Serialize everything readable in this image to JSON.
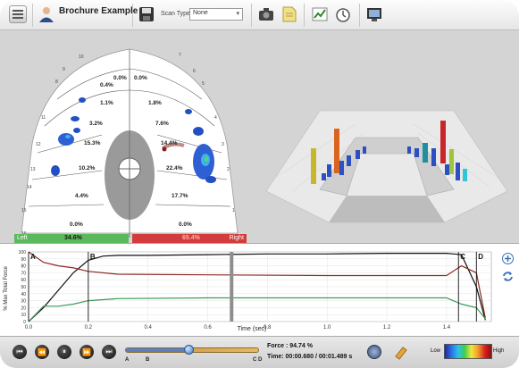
{
  "toolbar": {
    "title": "Brochure Example",
    "scan_type_label": "Scan Type:",
    "scan_type_value": "None"
  },
  "arch": {
    "left_values": [
      "0.0%",
      "0.4%",
      "1.1%",
      "3.2%",
      "15.3%",
      "10.2%",
      "4.4%",
      "0.0%"
    ],
    "right_values": [
      "0.0%",
      "1.8%",
      "7.6%",
      "14.4%",
      "22.4%",
      "17.7%",
      "0.0%"
    ],
    "tooth_numbers": [
      "10",
      "9",
      "8",
      "7",
      "11",
      "12",
      "13",
      "14",
      "15",
      "16",
      "6",
      "5",
      "4",
      "3",
      "2",
      "1"
    ],
    "left_label": "Left",
    "left_value": "34.6%",
    "right_label": "Right",
    "right_value": "65.4%"
  },
  "graph": {
    "ylabel": "% Max Total Force",
    "xlabel": "Time (sec)",
    "markers": [
      "A",
      "B",
      "C",
      "D"
    ],
    "zoom_icon": "zoom-in-icon",
    "refresh_icon": "refresh-icon"
  },
  "chart_data": {
    "type": "line",
    "xlabel": "Time (sec)",
    "ylabel": "% Max Total Force",
    "xlim": [
      0,
      1.55
    ],
    "ylim": [
      0,
      100
    ],
    "x_ticks": [
      "0.0",
      "0.2",
      "0.4",
      "0.6",
      "0.8",
      "1.0",
      "1.2",
      "1.4"
    ],
    "y_ticks": [
      "0",
      "10",
      "20",
      "30",
      "40",
      "50",
      "60",
      "70",
      "80",
      "90",
      "100"
    ],
    "series": [
      {
        "color": "#111111",
        "x": [
          0.0,
          0.05,
          0.1,
          0.15,
          0.2,
          0.25,
          0.3,
          0.4,
          0.6,
          0.8,
          1.0,
          1.2,
          1.4,
          1.45,
          1.5,
          1.53
        ],
        "y": [
          0,
          20,
          45,
          70,
          88,
          94,
          95,
          95,
          96,
          97,
          97,
          98,
          98,
          96,
          50,
          2
        ]
      },
      {
        "color": "#8b2a22",
        "x": [
          0.0,
          0.05,
          0.1,
          0.15,
          0.2,
          0.3,
          0.6,
          1.0,
          1.4,
          1.45,
          1.5,
          1.53
        ],
        "y": [
          100,
          85,
          80,
          77,
          72,
          68,
          67,
          66,
          66,
          80,
          70,
          5
        ]
      },
      {
        "color": "#3a9a55",
        "x": [
          0.0,
          0.05,
          0.1,
          0.15,
          0.2,
          0.3,
          0.6,
          1.0,
          1.4,
          1.45,
          1.5,
          1.53
        ],
        "y": [
          0,
          22,
          22,
          25,
          30,
          33,
          34,
          34,
          34,
          25,
          20,
          4
        ]
      }
    ],
    "markers": [
      {
        "label": "A",
        "x": 0.0
      },
      {
        "label": "B",
        "x": 0.2
      },
      {
        "label": "C",
        "x": 1.44
      },
      {
        "label": "D",
        "x": 1.5
      }
    ],
    "cursor_x": 0.68
  },
  "playback": {
    "marker_labels": [
      "A",
      "B",
      "C",
      "D"
    ],
    "force_text": "Force : 94.74 %",
    "time_text": "Time: 00:00.680 / 00:01.489 s",
    "legend_low": "Low",
    "legend_high": "High",
    "progress": 0.47
  },
  "colors": {
    "left_bar": "#5cb85c",
    "right_bar": "#d23c3c"
  }
}
